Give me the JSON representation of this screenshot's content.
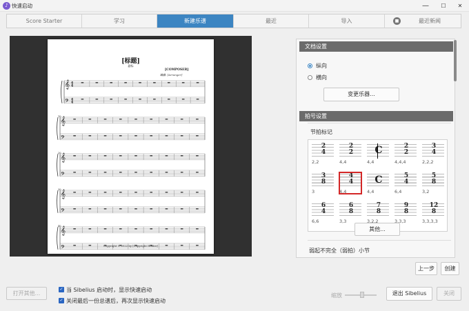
{
  "window": {
    "title": "快速启动",
    "minimize": "—",
    "maximize": "☐",
    "close": "✕"
  },
  "tabs": [
    {
      "label": "Score Starter"
    },
    {
      "label": "学习"
    },
    {
      "label": "新建乐谱"
    },
    {
      "label": "最近"
    },
    {
      "label": "导入"
    },
    {
      "label": "最近新闻"
    }
  ],
  "preview": {
    "title": "[标题]",
    "subtitle": "副标",
    "composer": "[COMPOSER]",
    "arranger": "编曲: [Arranger]",
    "copyright": "Copyright © 2022 by [Copyright Holder]",
    "measure_numbers": [
      "10",
      "20",
      "30",
      "40"
    ]
  },
  "doc_settings": {
    "heading": "文档设置",
    "options": [
      {
        "label": "纵向",
        "selected": true
      },
      {
        "label": "横向",
        "selected": false
      }
    ],
    "change_instruments": "变更乐器..."
  },
  "time_sig": {
    "heading": "拍号设置",
    "group_label": "节拍标记",
    "items": [
      {
        "num": "2",
        "den": "4",
        "grouping": "2,2"
      },
      {
        "num": "2",
        "den": "2",
        "grouping": "4,4"
      },
      {
        "num": "C",
        "den": "",
        "grouping": "4,4",
        "cut": true
      },
      {
        "num": "2",
        "den": "2",
        "grouping": "4,4,4"
      },
      {
        "num": "3",
        "den": "4",
        "grouping": "2,2,2"
      },
      {
        "num": "3",
        "den": "8",
        "grouping": "3"
      },
      {
        "num": "4",
        "den": "4",
        "grouping": "4,4",
        "selected": true
      },
      {
        "num": "C",
        "den": "",
        "grouping": "4,4"
      },
      {
        "num": "5",
        "den": "4",
        "grouping": "6,4"
      },
      {
        "num": "5",
        "den": "8",
        "grouping": "3,2"
      },
      {
        "num": "6",
        "den": "4",
        "grouping": "6,6"
      },
      {
        "num": "6",
        "den": "8",
        "grouping": "3,3"
      },
      {
        "num": "7",
        "den": "8",
        "grouping": "3,2,2"
      },
      {
        "num": "9",
        "den": "8",
        "grouping": "3,3,3"
      },
      {
        "num": "12",
        "den": "8",
        "grouping": "3,3,3,3"
      }
    ],
    "other_button": "其他...",
    "pickup_label": "弱起不完全（弱拍）小节"
  },
  "nav": {
    "prev": "上一步",
    "create": "创建"
  },
  "bottom": {
    "open_other": "打开其他...",
    "check_show": "当 Sibelius 启动时，显示快速启动",
    "check_reshow": "关闭最后一份总谱后，再次显示快速启动",
    "zoom_label": "缩放",
    "exit": "退出 Sibelius",
    "close": "关闭"
  },
  "colors": {
    "accent": "#3c85c2",
    "selection": "#d32626",
    "section_header": "#6b6b6b"
  }
}
